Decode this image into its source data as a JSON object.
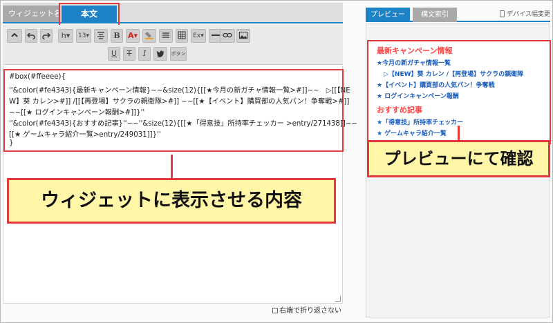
{
  "editor": {
    "tab_widget_name": "ウィジェット名",
    "tab_body": "本文",
    "toolbar": {
      "row1": [
        "caret-up-icon",
        "undo-icon",
        "redo-icon",
        "h▾",
        "13▾",
        "align-menu-icon",
        "B",
        "A▾",
        "highlight-icon",
        "list-menu-icon",
        "table-icon",
        "Ex▾",
        "hr-icon",
        "link-icon",
        "image-icon"
      ],
      "row2": [
        "U",
        "T",
        "I",
        "twitter-icon",
        "ボタン"
      ]
    },
    "code_lines": [
      "#box(#ffeeee){",
      "''&color(#fe4343){最新キャンペーン情報}~~&size(12){[[★今月の新ガチャ情報一覧>#]]~~　▷[[【NE",
      "W】葵 カレン>#]] /[[【再登場】サクラの親衛隊>#]] ~~[[★【イベント】購買部の人気パン！争奪戦>#]]",
      "~~[[★ ログインキャンペーン報酬>#]]}''",
      "''&color(#fe4343){おすすめ記事}''~~''&size(12){[[★「得意技」所持率チェッカー >entry/271438]]~~",
      "[[★ ゲームキャラ紹介一覧>entry/249031]]}''",
      "}"
    ],
    "wrap_option": "右端で折り返さない"
  },
  "preview": {
    "tab_preview": "プレビュー",
    "tab_syntax": "構文索引",
    "device_toggle": "デバイス幅変更",
    "sections": [
      {
        "heading": "最新キャンペーン情報",
        "color": "#fe4343",
        "lines": [
          "★今月の新ガチャ情報一覧",
          "▷【NEW】葵 カレン /【再登場】サクラの親衛隊",
          "★【イベント】購買部の人気パン！争奪戦",
          "★ ログインキャンペーン報酬"
        ]
      },
      {
        "heading": "おすすめ記事",
        "color": "#fe4343",
        "lines": [
          "★「得意技」所持率チェッカー",
          "★ ゲームキャラ紹介一覧"
        ]
      }
    ]
  },
  "callouts": {
    "left": "ウィジェットに表示させる内容",
    "right": "プレビューにて確認"
  },
  "colors": {
    "accent": "#1d83c6",
    "highlight_border": "#e23a3a",
    "callout_fill": "#fff6a8",
    "link": "#1a5ebd"
  }
}
